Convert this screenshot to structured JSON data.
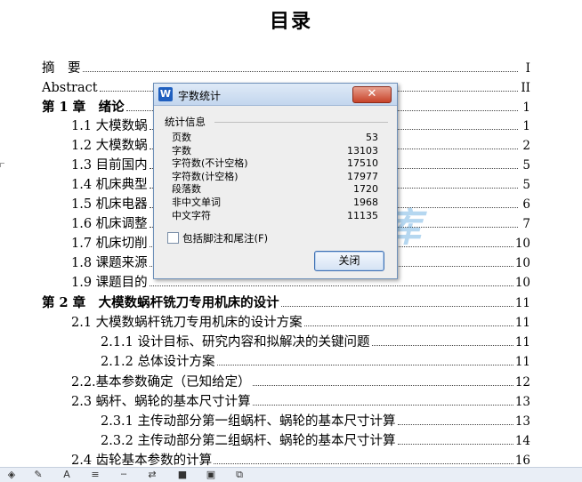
{
  "document": {
    "title": "目录",
    "toc": [
      {
        "text": "摘　要",
        "page": "I",
        "level": 1,
        "strong": false
      },
      {
        "text": "Abstract",
        "page": "II",
        "level": 1,
        "strong": false
      },
      {
        "text": "第 1 章　绪论",
        "page": "1",
        "level": 1,
        "strong": true
      },
      {
        "text": "1.1 大模数蜗",
        "page": "1",
        "level": 2,
        "strong": false
      },
      {
        "text": "1.2 大模数蜗",
        "page": "2",
        "level": 2,
        "strong": false
      },
      {
        "text": "1.3 目前国内",
        "page": "5",
        "level": 2,
        "strong": false
      },
      {
        "text": "1.4 机床典型",
        "page": "5",
        "level": 2,
        "strong": false
      },
      {
        "text": "1.5 机床电器",
        "page": "6",
        "level": 2,
        "strong": false
      },
      {
        "text": "1.6 机床调整",
        "page": "7",
        "level": 2,
        "strong": false
      },
      {
        "text": "1.7 机床切削",
        "page": "10",
        "level": 2,
        "strong": false
      },
      {
        "text": "1.8 课题来源",
        "page": "10",
        "level": 2,
        "strong": false
      },
      {
        "text": "1.9 课题目的",
        "page": "10",
        "level": 2,
        "strong": false
      },
      {
        "text": "第 2 章　大模数蜗杆铣刀专用机床的设计",
        "page": "11",
        "level": 1,
        "strong": true
      },
      {
        "text": "2.1 大模数蜗杆铣刀专用机床的设计方案",
        "page": "11",
        "level": 2,
        "strong": false
      },
      {
        "text": "2.1.1 设计目标、研究内容和拟解决的关键问题",
        "page": "11",
        "level": 3,
        "strong": false
      },
      {
        "text": "2.1.2 总体设计方案",
        "page": "11",
        "level": 3,
        "strong": false
      },
      {
        "text": "2.2.基本参数确定（已知给定）",
        "page": "12",
        "level": 2,
        "strong": false
      },
      {
        "text": "2.3 蜗杆、蜗轮的基本尺寸计算",
        "page": "13",
        "level": 2,
        "strong": false
      },
      {
        "text": "2.3.1 主传动部分第一组蜗杆、蜗轮的基本尺寸计算",
        "page": "13",
        "level": 3,
        "strong": false
      },
      {
        "text": "2.3.2 主传动部分第二组蜗杆、蜗轮的基本尺寸计算",
        "page": "14",
        "level": 3,
        "strong": false
      },
      {
        "text": "2.4 齿轮基本参数的计算",
        "page": "16",
        "level": 2,
        "strong": false
      }
    ]
  },
  "watermark": {
    "text_left": "人",
    "text_right": "文库"
  },
  "dialog": {
    "icon_letter": "W",
    "title": "字数统计",
    "close_label": "✕",
    "group_label": "统计信息",
    "stats": [
      {
        "label": "页数",
        "value": "53"
      },
      {
        "label": "字数",
        "value": "13103"
      },
      {
        "label": "字符数(不计空格)",
        "value": "17510"
      },
      {
        "label": "字符数(计空格)",
        "value": "17977"
      },
      {
        "label": "段落数",
        "value": "1720"
      },
      {
        "label": "非中文单词",
        "value": "1968"
      },
      {
        "label": "中文字符",
        "value": "11135"
      }
    ],
    "checkbox_label": "包括脚注和尾注(F)",
    "ok_label": "关闭"
  },
  "toolbar": {
    "icons": [
      {
        "name": "paint-bucket-icon",
        "glyph": "◈"
      },
      {
        "name": "pen-icon",
        "glyph": "✎"
      },
      {
        "name": "font-color-icon",
        "glyph": "A"
      },
      {
        "name": "line-style-icon",
        "glyph": "≡"
      },
      {
        "name": "dash-style-icon",
        "glyph": "┄"
      },
      {
        "name": "arrow-style-icon",
        "glyph": "⇄"
      },
      {
        "name": "shadow-icon",
        "glyph": "■"
      },
      {
        "name": "3d-icon",
        "glyph": "▣"
      },
      {
        "name": "clip-icon",
        "glyph": "⧉"
      }
    ]
  }
}
